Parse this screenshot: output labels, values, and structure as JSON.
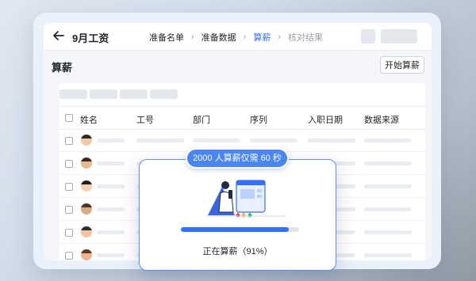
{
  "window": {
    "title": "9月工资"
  },
  "steps": [
    {
      "label": "准备名单",
      "state": "done"
    },
    {
      "label": "准备数据",
      "state": "done"
    },
    {
      "label": "算薪",
      "state": "active"
    },
    {
      "label": "核对结果",
      "state": "todo"
    }
  ],
  "section": {
    "title": "算薪",
    "start_button": "开始算薪"
  },
  "table": {
    "columns": [
      "姓名",
      "工号",
      "部门",
      "序列",
      "入职日期",
      "数据来源"
    ],
    "row_count": 7
  },
  "modal": {
    "banner": "2000 人算薪仅需 60 秒",
    "progress": 0.91,
    "status": "正在算薪（91%）"
  },
  "colors": {
    "accent": "#3370ff",
    "banner": "#4a86f2"
  },
  "icons": {
    "back": "arrow-left-icon"
  }
}
